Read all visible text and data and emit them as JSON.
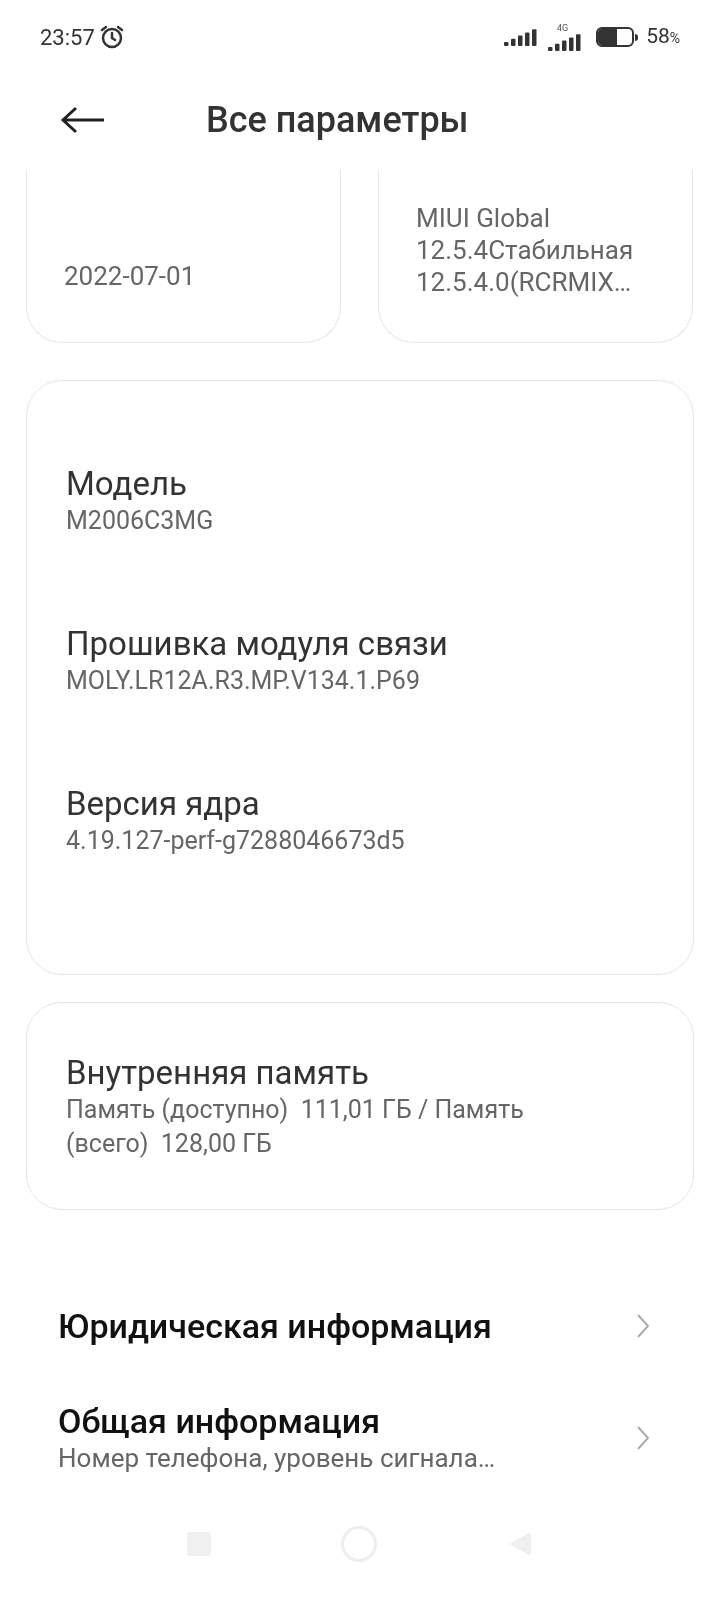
{
  "status_bar": {
    "time": "23:57",
    "network": "4G",
    "battery_percent": "58",
    "battery_unit": "%",
    "battery": {
      "level": 0.55
    }
  },
  "header": {
    "title": "Все параметры"
  },
  "top_cards": [
    {
      "value": "2022-07-01"
    },
    {
      "value": "MIUI Global 12.5.4Стабильная 12.5.4.0(RCRMIX…"
    }
  ],
  "details_card": [
    {
      "label": "Модель",
      "value": "M2006C3MG"
    },
    {
      "label": "Прошивка модуля связи",
      "value": "MOLY.LR12A.R3.MP.V134.1.P69"
    },
    {
      "label": "Версия ядра",
      "value": "4.19.127-perf-g7288046673d5"
    }
  ],
  "storage_card": {
    "label": "Внутренняя память",
    "value": "Память (доступно)  111,01 ГБ / Память (всего)  128,00 ГБ"
  },
  "menu": [
    {
      "title": "Юридическая информация"
    },
    {
      "title": "Общая информация",
      "subtitle": "Номер телефона, уровень сигнала…"
    }
  ]
}
